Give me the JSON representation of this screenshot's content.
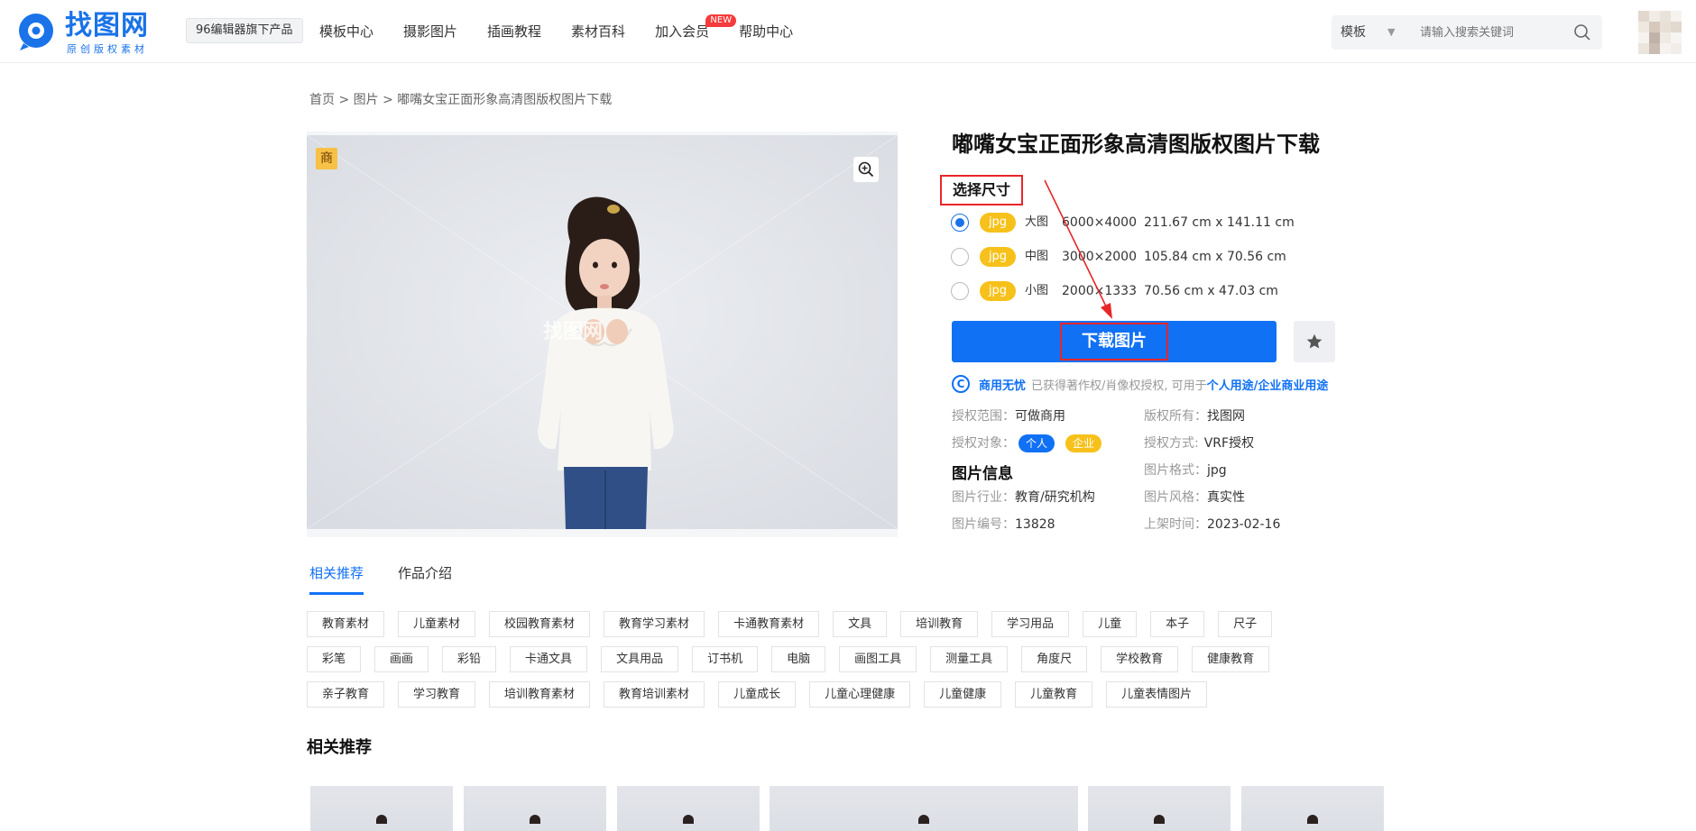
{
  "header": {
    "logo_text": "找图网",
    "logo_sub": "原创版权素材",
    "tag_96": "96编辑器旗下产品",
    "nav": [
      {
        "label": "模板中心",
        "new": false
      },
      {
        "label": "摄影图片",
        "new": false
      },
      {
        "label": "插画教程",
        "new": false
      },
      {
        "label": "素材百科",
        "new": false
      },
      {
        "label": "加入会员",
        "new": true
      },
      {
        "label": "帮助中心",
        "new": false
      }
    ],
    "new_badge": "NEW",
    "search": {
      "category": "模板",
      "placeholder": "请输入搜索关键词"
    }
  },
  "breadcrumb": "首页 > 图片 > 嘟嘴女宝正面形象高清图版权图片下载",
  "photo": {
    "badge": "商",
    "watermark": "找图网"
  },
  "detail": {
    "title": "嘟嘴女宝正面形象高清图版权图片下载",
    "size_label": "选择尺寸",
    "sizes": [
      {
        "format": "jpg",
        "name": "大图",
        "px": "6000×4000",
        "cm": "211.67 cm x 141.11 cm",
        "selected": true
      },
      {
        "format": "jpg",
        "name": "中图",
        "px": "3000×2000",
        "cm": "105.84 cm x 70.56 cm",
        "selected": false
      },
      {
        "format": "jpg",
        "name": "小图",
        "px": "2000×1333",
        "cm": "70.56 cm x 47.03 cm",
        "selected": false
      }
    ],
    "download_label": "下载图片",
    "license": {
      "strong": "商用无忧",
      "text": "已获得著作权/肖像权授权, 可用于",
      "link": "个人用途/企业商业用途"
    },
    "info": {
      "scope_k": "授权范围：",
      "scope_v": "可做商用",
      "owner_k": "版权所有：",
      "owner_v": "找图网",
      "target_k": "授权对象：",
      "target_personal": "个人",
      "target_company": "企业",
      "method_k": "授权方式:",
      "method_v": "VRF授权",
      "section_title": "图片信息",
      "format_k": "图片格式：",
      "format_v": "jpg",
      "industry_k": "图片行业：",
      "industry_v": "教育/研究机构",
      "style_k": "图片风格：",
      "style_v": "真实性",
      "id_k": "图片编号：",
      "id_v": "13828",
      "date_k": "上架时间：",
      "date_v": "2023-02-16"
    },
    "colors": {
      "accent": "#1171f5",
      "highlight_red": "#e8262a",
      "jpg_yellow": "#f7c11b"
    }
  },
  "tabs": [
    "相关推荐",
    "作品介绍"
  ],
  "keywords": [
    "教育素材",
    "儿童素材",
    "校园教育素材",
    "教育学习素材",
    "卡通教育素材",
    "文具",
    "培训教育",
    "学习用品",
    "儿童",
    "本子",
    "尺子",
    "彩笔",
    "画画",
    "彩铅",
    "卡通文具",
    "文具用品",
    "订书机",
    "电脑",
    "画图工具",
    "测量工具",
    "角度尺",
    "学校教育",
    "健康教育",
    "亲子教育",
    "学习教育",
    "培训教育素材",
    "教育培训素材",
    "儿童成长",
    "儿童心理健康",
    "儿童健康",
    "儿童教育",
    "儿童表情图片"
  ],
  "related_title": "相关推荐"
}
